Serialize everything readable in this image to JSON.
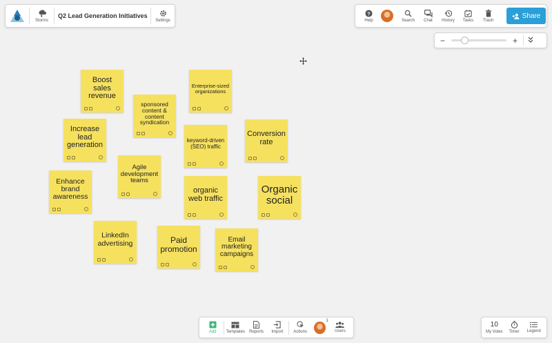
{
  "header": {
    "storms_label": "Storms",
    "title": "Q2 Lead Generation Initiatives",
    "settings_label": "Settings"
  },
  "toolbar": {
    "help_label": "Help",
    "search_label": "Search",
    "chat_label": "Chat",
    "history_label": "History",
    "tasks_label": "Tasks",
    "trash_label": "Trash",
    "share_label": "Share"
  },
  "zoom": {
    "minus": "−",
    "plus": "+",
    "level_fraction": 0.2
  },
  "notes": [
    {
      "text": "Boost sales revenue"
    },
    {
      "text": "Enterprise-sized organizations"
    },
    {
      "text": "sponsored content & content syndication"
    },
    {
      "text": "Increase lead generation"
    },
    {
      "text": "keyword-driven (SEO) traffic"
    },
    {
      "text": "Conversion rate"
    },
    {
      "text": "Agile development teams"
    },
    {
      "text": "Enhance brand awareness"
    },
    {
      "text": "organic web traffic"
    },
    {
      "text": "Organic social"
    },
    {
      "text": "LinkedIn advertising"
    },
    {
      "text": "Paid promotion"
    },
    {
      "text": "Email marketing campaigns"
    }
  ],
  "bottom_toolbar": {
    "add_label": "Add",
    "templates_label": "Templates",
    "reports_label": "Reports",
    "import_label": "Import",
    "actions_label": "Actions",
    "avatar_badge": "1",
    "users_label": "Users"
  },
  "bottom_right": {
    "votes_count": "10",
    "votes_label": "My Votes",
    "timer_label": "Timer",
    "legend_label": "Legend"
  },
  "colors": {
    "note": "#f6e15f",
    "share_button": "#2a9fd8",
    "add_icon": "#3cb878",
    "canvas": "#f1f1f1"
  }
}
